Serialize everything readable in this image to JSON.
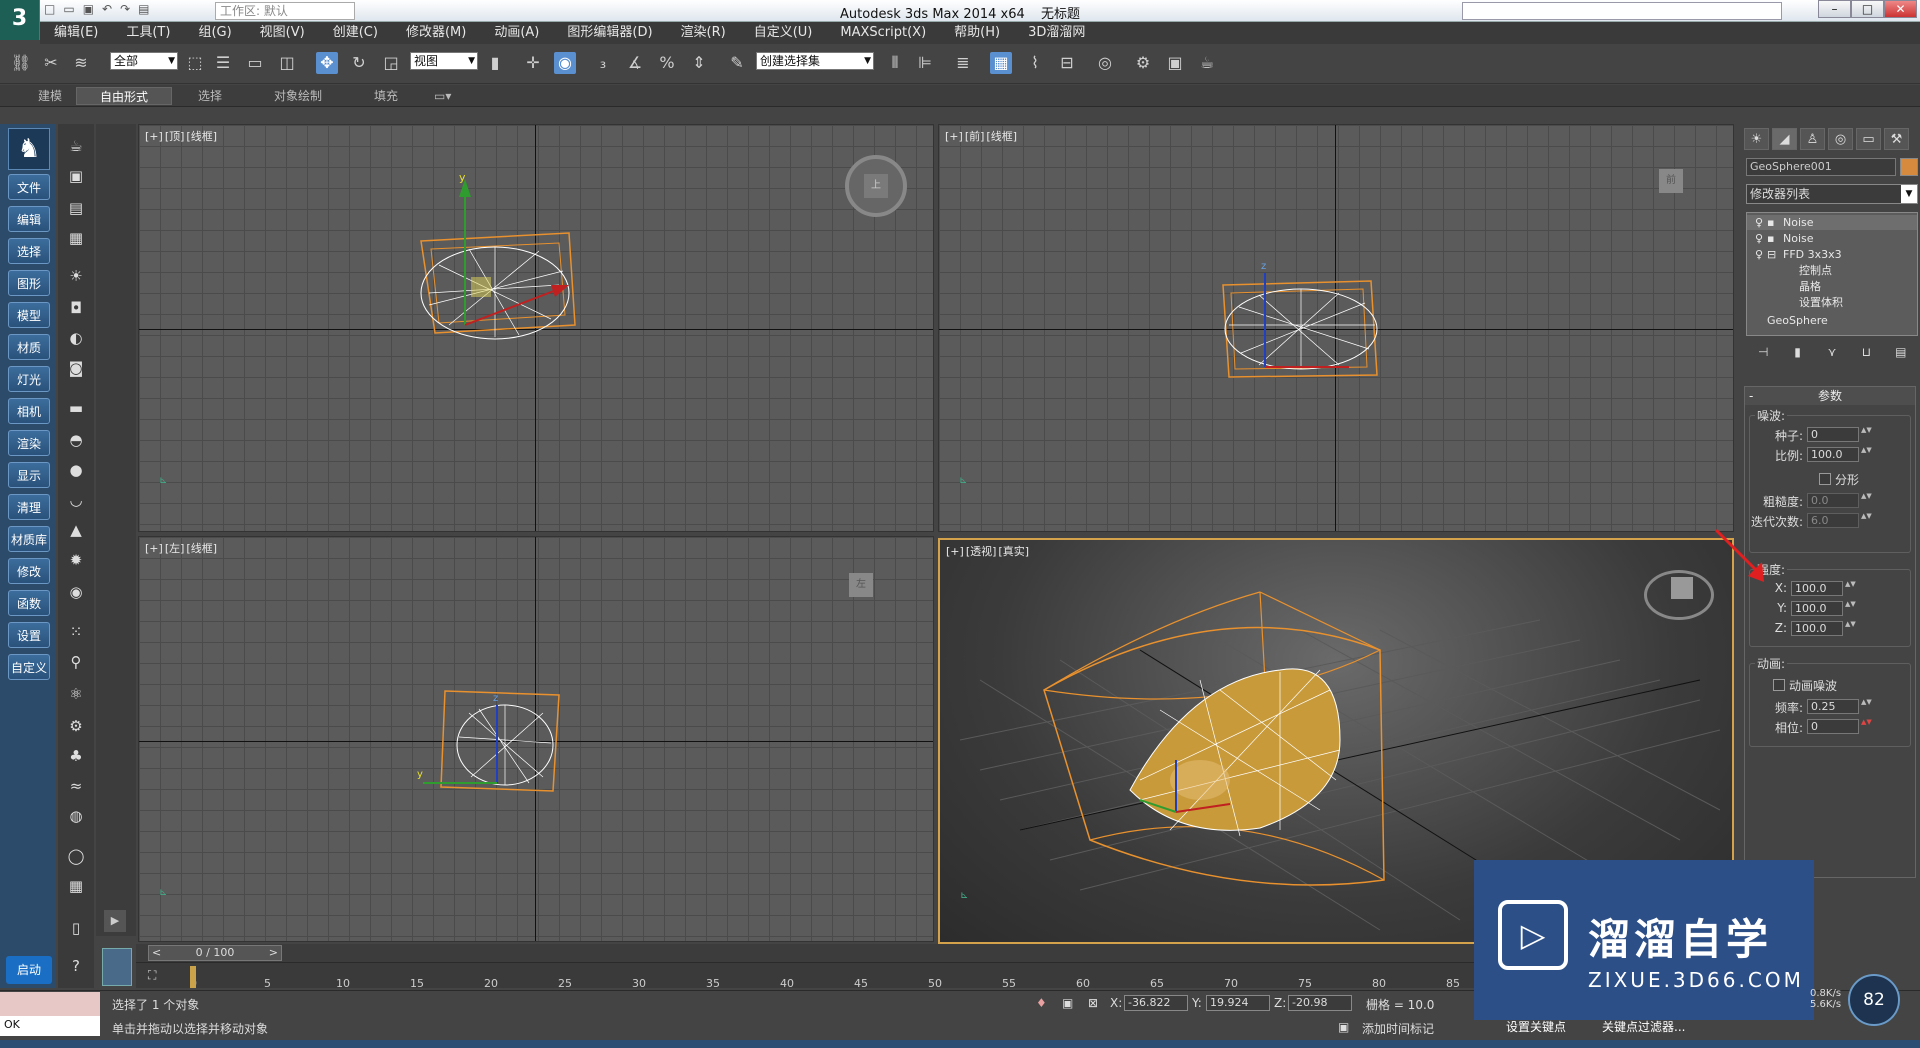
{
  "titlebar": {
    "app_title": "Autodesk 3ds Max  2014 x64",
    "file_title": "无标题",
    "workspace": "工作区: 默认"
  },
  "window_controls": {
    "minimize": "–",
    "maximize": "□",
    "close": "✕"
  },
  "menu": [
    "编辑(E)",
    "工具(T)",
    "组(G)",
    "视图(V)",
    "创建(C)",
    "修改器(M)",
    "动画(A)",
    "图形编辑器(D)",
    "渲染(R)",
    "自定义(U)",
    "MAXScript(X)",
    "帮助(H)",
    "3D溜溜网"
  ],
  "toolbar": {
    "selection_filter": "全部",
    "ref_coord": "视图",
    "named_selection": "创建选择集"
  },
  "ribbon_tabs": [
    "建模",
    "自由形式",
    "选择",
    "对象绘制",
    "填充"
  ],
  "left_nav": [
    "文件",
    "编辑",
    "选择",
    "图形",
    "模型",
    "材质",
    "灯光",
    "相机",
    "渲染",
    "显示",
    "清理",
    "材质库",
    "修改",
    "函数",
    "设置",
    "自定义"
  ],
  "start_button": "启动",
  "viewports": [
    {
      "id": "top",
      "label": [
        "[+]",
        "[顶]",
        "[线框]"
      ],
      "cube": "上"
    },
    {
      "id": "front",
      "label": [
        "[+]",
        "[前]",
        "[线框]"
      ],
      "cube": "前"
    },
    {
      "id": "left",
      "label": [
        "[+]",
        "[左]",
        "[线框]"
      ],
      "cube": "左"
    },
    {
      "id": "persp",
      "label": [
        "[+]",
        "[透视]",
        "[真实]"
      ],
      "cube": ""
    }
  ],
  "command_panel": {
    "object_name": "GeoSphere001",
    "object_color": "#d58a3e",
    "modifier_list": "修改器列表",
    "stack": [
      {
        "label": "Noise",
        "level": 0,
        "selected": true
      },
      {
        "label": "Noise",
        "level": 0,
        "selected": false
      },
      {
        "label": "FFD 3x3x3",
        "level": 0,
        "selected": false
      },
      {
        "label": "控制点",
        "level": 1,
        "selected": false
      },
      {
        "label": "晶格",
        "level": 1,
        "selected": false
      },
      {
        "label": "设置体积",
        "level": 1,
        "selected": false
      },
      {
        "label": "GeoSphere",
        "level": 0,
        "selected": false
      }
    ],
    "params": {
      "title": "参数",
      "noise_group": "噪波:",
      "seed_label": "种子:",
      "seed": "0",
      "scale_label": "比例:",
      "scale": "100.0",
      "fractal_label": "分形",
      "roughness_label": "粗糙度:",
      "roughness": "0.0",
      "iterations_label": "迭代次数:",
      "iterations": "6.0",
      "strength_group": "强度:",
      "x_label": "X:",
      "x": "100.0",
      "y_label": "Y:",
      "y": "100.0",
      "z_label": "Z:",
      "z": "100.0",
      "anim_group": "动画:",
      "anim_noise_label": "动画噪波",
      "freq_label": "频率:",
      "freq": "0.25",
      "phase_label": "相位:",
      "phase": "0"
    }
  },
  "timeline": {
    "slider": "0 / 100",
    "ticks": [
      "0",
      "5",
      "10",
      "15",
      "20",
      "25",
      "30",
      "35",
      "40",
      "45",
      "50",
      "55",
      "60",
      "65",
      "70",
      "75",
      "80",
      "85"
    ]
  },
  "status": {
    "selected": "选择了 1 个对象",
    "hint": "单击并拖动以选择并移动对象",
    "ok": "OK",
    "x_label": "X:",
    "x": "-36.822",
    "y_label": "Y:",
    "y": "19.924",
    "z_label": "Z:",
    "z": "-20.98",
    "grid": "栅格 = 10.0",
    "add_time_tag": "添加时间标记",
    "set_key": "设置关键点",
    "key_filters": "关键点过滤器...",
    "speed_percent": "82",
    "speed_up": "0.8K/s",
    "speed_down": "5.6K/s"
  },
  "watermark": {
    "cn": "溜溜自学",
    "en": "ZIXUE.3D66.COM"
  }
}
